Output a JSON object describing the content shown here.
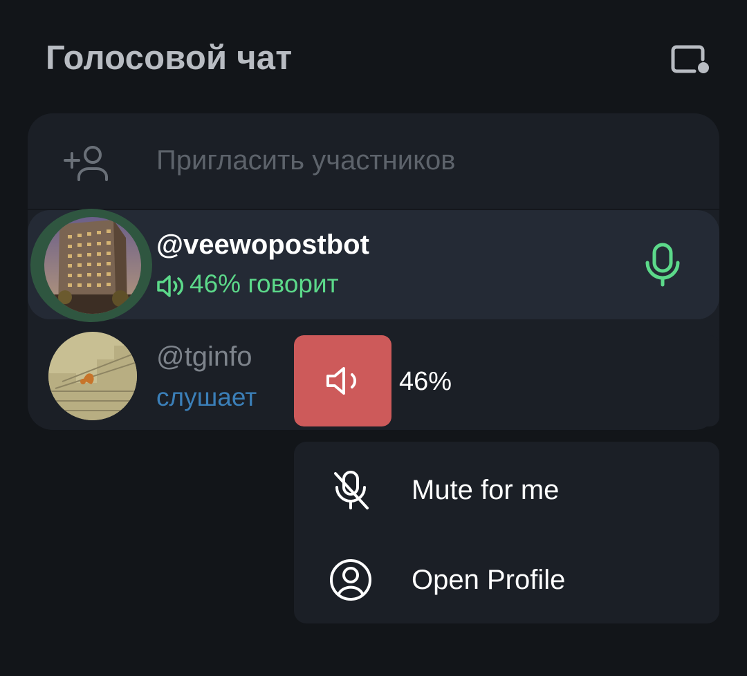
{
  "header": {
    "title": "Голосовой чат",
    "screen_icon": "screen-share-icon"
  },
  "invite": {
    "label": "Пригласить участников",
    "icon": "add-person-icon"
  },
  "participants": [
    {
      "name": "@veewopostbot",
      "status": "46% говорит",
      "status_icon": "speaker-icon",
      "state": "speaking",
      "mic_icon": "microphone-icon",
      "status_color": "#5cd98a"
    },
    {
      "name": "@tginfo",
      "status": "слушает",
      "state": "listening",
      "status_color": "#3b7fb8"
    }
  ],
  "volume": {
    "label": "46%",
    "level": 0.23,
    "icon": "speaker-icon",
    "fill_color": "#cd5a5a"
  },
  "context_menu": {
    "items": [
      {
        "label": "Mute for me",
        "icon": "mic-off-icon"
      },
      {
        "label": "Open Profile",
        "icon": "profile-icon"
      }
    ]
  },
  "colors": {
    "background": "#12151b",
    "card": "#1b1f26",
    "active_row": "#242a35",
    "speaking_green": "#5cd98a",
    "listening_blue": "#3b7fb8"
  }
}
